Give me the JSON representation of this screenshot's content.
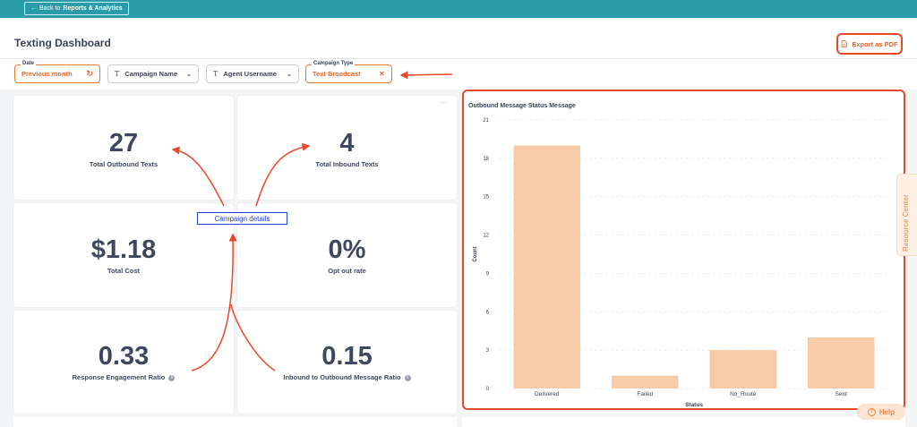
{
  "topbar": {
    "back_prefix": "Back to",
    "back_target": "Reports & Analytics",
    "back_icon": "arrow-left-icon"
  },
  "header": {
    "title": "Texting Dashboard",
    "export_label": "Export as PDF",
    "export_icon": "document-icon"
  },
  "filters": {
    "date": {
      "label": "Date",
      "value": "Previous month",
      "icon": "reset-icon"
    },
    "campaign_name": {
      "value": "Campaign Name"
    },
    "agent_username": {
      "value": "Agent Username"
    },
    "campaign_type": {
      "label": "Campaign Type",
      "value": "Text Broadcast",
      "icon": "close-icon"
    }
  },
  "metrics": [
    {
      "value": "27",
      "label": "Total Outbound Texts"
    },
    {
      "value": "4",
      "label": "Total Inbound Texts"
    },
    {
      "value": "$1.18",
      "label": "Total Cost"
    },
    {
      "value": "0%",
      "label": "Opt out rate"
    },
    {
      "value": "0.33",
      "label": "Response Engagement Ratio"
    },
    {
      "value": "0.15",
      "label": "Inbound to Outbound Message Ratio"
    }
  ],
  "annotation": {
    "label": "Campaign details",
    "color": "#2a3fd6",
    "arrow_color": "#e8492a"
  },
  "side": {
    "resource_center": "Resource Center",
    "help": "Help",
    "kebab": "···"
  },
  "chart_data": {
    "type": "bar",
    "title": "Outbound Message Status Message",
    "xlabel": "Status",
    "ylabel": "Count",
    "categories": [
      "Delivered",
      "Failed",
      "No_Route",
      "Sent"
    ],
    "values": [
      19,
      1,
      3,
      4
    ],
    "yticks": [
      0,
      3,
      6,
      9,
      12,
      15,
      18,
      21
    ],
    "ylim": [
      0,
      21
    ],
    "bar_color": "#f7cba8",
    "grid": true
  },
  "colors": {
    "accent": "#e8682a",
    "topbar": "#2a9ba8",
    "highlight": "#e8492a"
  }
}
